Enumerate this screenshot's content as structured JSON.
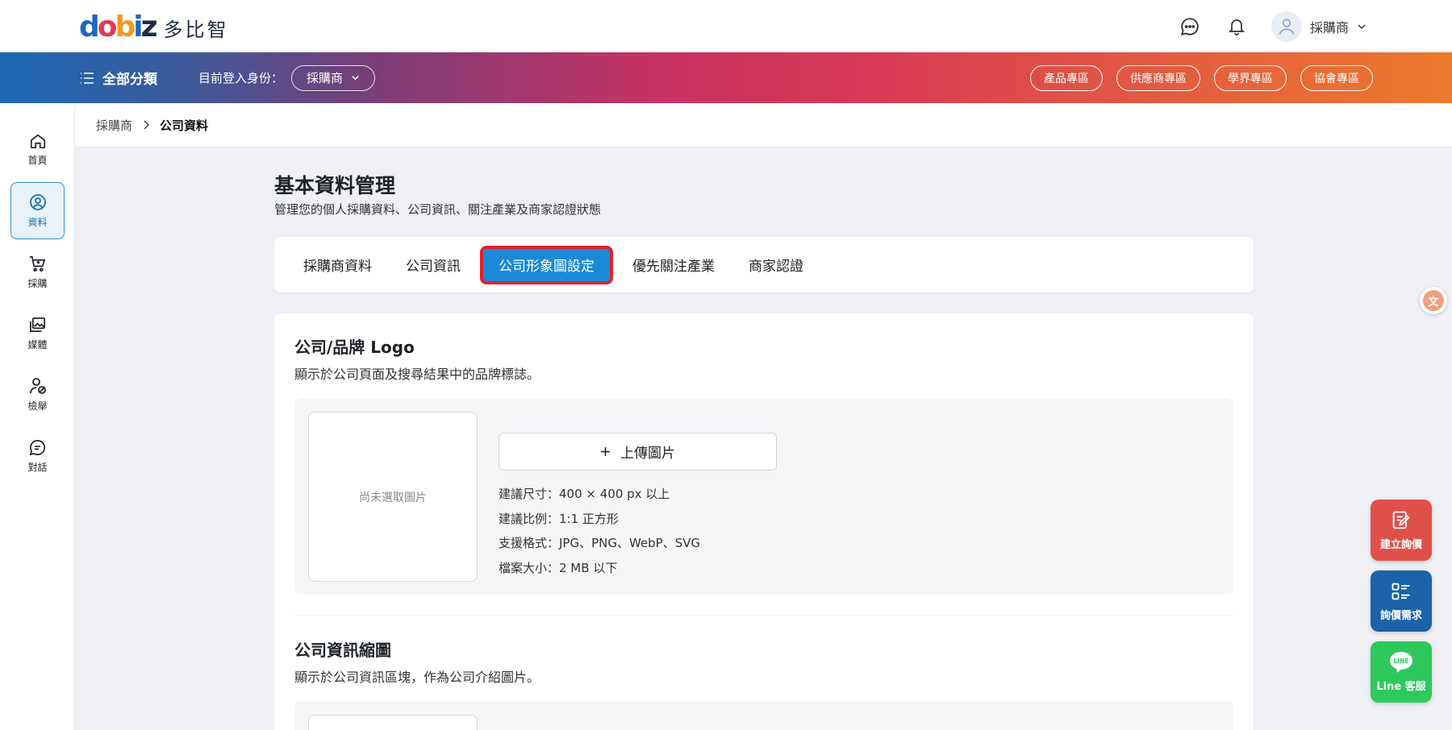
{
  "header": {
    "logo_mark": "dobiz",
    "logo_text": "多比智",
    "user_name": "採購商"
  },
  "nav": {
    "all_categories": "全部分類",
    "identity_label": "目前登入身份：",
    "identity_value": "採購商",
    "zones": [
      "產品專區",
      "供應商專區",
      "學界專區",
      "協會專區"
    ]
  },
  "sidebar": {
    "items": [
      {
        "label": "首頁",
        "icon": "home-icon"
      },
      {
        "label": "資料",
        "icon": "user-circle-icon"
      },
      {
        "label": "採購",
        "icon": "cart-icon"
      },
      {
        "label": "媒體",
        "icon": "media-icon"
      },
      {
        "label": "檢舉",
        "icon": "report-user-icon"
      },
      {
        "label": "對話",
        "icon": "chat-icon"
      }
    ],
    "active_index": 1
  },
  "breadcrumb": {
    "parent": "採購商",
    "current": "公司資料"
  },
  "page": {
    "title": "基本資料管理",
    "description": "管理您的個人採購資料、公司資訊、關注產業及商家認證狀態"
  },
  "tabs": {
    "items": [
      "採購商資料",
      "公司資訊",
      "公司形象圖設定",
      "優先關注產業",
      "商家認證"
    ],
    "active_index": 2
  },
  "logo_section": {
    "title": "公司/品牌 Logo",
    "description": "顯示於公司頁面及搜尋結果中的品牌標誌。",
    "preview_placeholder": "尚未選取圖片",
    "upload_label": "上傳圖片",
    "specs": [
      "建議尺寸：400 × 400 px 以上",
      "建議比例：1:1 正方形",
      "支援格式：JPG、PNG、WebP、SVG",
      "檔案大小：2 MB 以下"
    ]
  },
  "thumb_section": {
    "title": "公司資訊縮圖",
    "description": "顯示於公司資訊區塊，作為公司介紹圖片。"
  },
  "floating": {
    "create_inquiry": "建立詢價",
    "inquiry_demand": "詢價需求",
    "line_service": "Line 客服",
    "line_badge": "LINE"
  },
  "colors": {
    "primary": "#1a8ad8",
    "highlight_outline": "#e0232e",
    "fab_red": "#e0504a",
    "fab_blue": "#1b62a8",
    "fab_green": "#2ec95c"
  }
}
